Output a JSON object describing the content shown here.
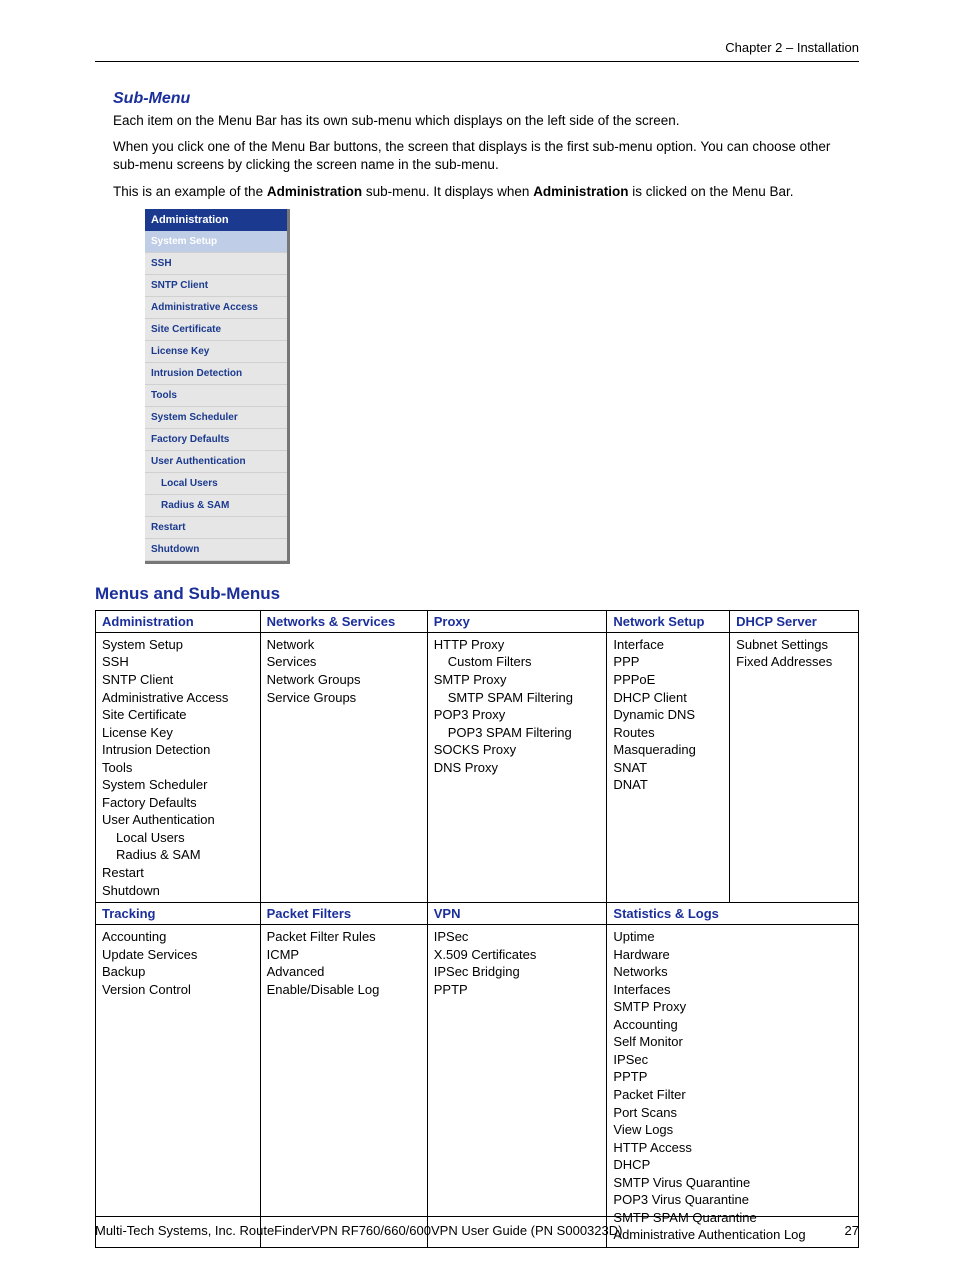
{
  "header": {
    "chapter": "Chapter 2 – Installation"
  },
  "sub_menu": {
    "heading": "Sub-Menu",
    "para1": "Each item on the Menu Bar has its own sub-menu which displays on the left side of the screen.",
    "para2": "When you click one of the Menu Bar buttons, the screen that displays is the first sub-menu option. You can choose other sub-menu screens by clicking the screen name in the sub-menu.",
    "para3_pre": "This is an example of the ",
    "para3_b1": "Administration",
    "para3_mid": " sub-menu. It displays when ",
    "para3_b2": "Administration",
    "para3_post": " is clicked on the Menu Bar.",
    "panel_title": "Administration",
    "panel_items": [
      "System Setup",
      "SSH",
      "SNTP Client",
      "Administrative Access",
      "Site Certificate",
      "License Key",
      "Intrusion Detection",
      "Tools",
      "System Scheduler",
      "Factory Defaults",
      "User Authentication",
      "Local Users",
      "Radius & SAM",
      "Restart",
      "Shutdown"
    ]
  },
  "menus_section": {
    "heading": "Menus and Sub-Menus",
    "row1_headers": [
      "Administration",
      "Networks & Services",
      "Proxy",
      "Network Setup",
      "DHCP Server"
    ],
    "row1": {
      "admin": [
        "System Setup",
        "SSH",
        "SNTP Client",
        "Administrative Access",
        "Site Certificate",
        "License Key",
        "Intrusion Detection",
        "Tools",
        "System Scheduler",
        "Factory Defaults",
        "User Authentication",
        "Local Users",
        "Radius & SAM",
        "Restart",
        "Shutdown"
      ],
      "networks": [
        "Network",
        "Services",
        "Network Groups",
        "Service Groups"
      ],
      "proxy": [
        "HTTP Proxy",
        "Custom Filters",
        "SMTP Proxy",
        "SMTP SPAM Filtering",
        "POP3 Proxy",
        "POP3 SPAM Filtering",
        "SOCKS Proxy",
        "DNS Proxy"
      ],
      "network_setup": [
        "Interface",
        "PPP",
        "PPPoE",
        "DHCP Client",
        "Dynamic DNS",
        "Routes",
        "Masquerading",
        "SNAT",
        "DNAT"
      ],
      "dhcp": [
        "Subnet Settings",
        "Fixed Addresses"
      ]
    },
    "row2_headers": [
      "Tracking",
      "Packet Filters",
      "VPN",
      "Statistics & Logs"
    ],
    "row2": {
      "tracking": [
        "Accounting",
        "Update Services",
        "Backup",
        "Version Control"
      ],
      "packet_filters": [
        "Packet Filter Rules",
        "ICMP",
        "Advanced",
        "Enable/Disable Log"
      ],
      "vpn": [
        "IPSec",
        "X.509 Certificates",
        "IPSec Bridging",
        "PPTP"
      ],
      "stats": [
        "Uptime",
        "Hardware",
        "Networks",
        "Interfaces",
        "SMTP Proxy",
        "Accounting",
        "Self Monitor",
        "IPSec",
        "PPTP",
        "Packet Filter",
        "Port Scans",
        "View Logs",
        "HTTP Access",
        "DHCP",
        "SMTP Virus Quarantine",
        "POP3 Virus Quarantine",
        "SMTP SPAM Quarantine",
        "Administrative Authentication Log"
      ]
    }
  },
  "footer": {
    "text": "Multi-Tech Systems, Inc. RouteFinderVPN RF760/660/600VPN User Guide (PN S000323D)",
    "page": "27"
  }
}
